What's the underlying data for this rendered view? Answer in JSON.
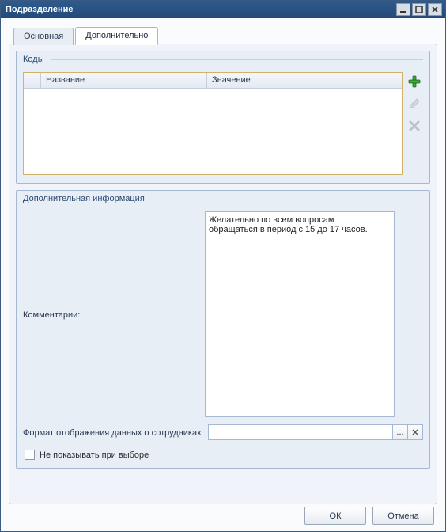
{
  "window": {
    "title": "Подразделение"
  },
  "tabs": {
    "main": "Основная",
    "extra": "Дополнительно"
  },
  "codes_group": {
    "legend": "Коды",
    "columns": {
      "name": "Название",
      "value": "Значение"
    }
  },
  "info_group": {
    "legend": "Дополнительная информация",
    "comments_label": "Комментарии:",
    "comments_value": "Желательно по всем вопросам обращаться в период с 15 до 17 часов.",
    "format_label": "Формат отображения данных о сотрудниках",
    "format_value": "",
    "format_ellipsis": "...",
    "hide_checkbox_label": "Не показывать при выборе"
  },
  "buttons": {
    "ok": "ОК",
    "cancel": "Отмена"
  },
  "icons": {
    "add": "add-icon",
    "edit": "edit-icon",
    "delete": "delete-icon",
    "minimize": "minimize-icon",
    "maximize": "maximize-icon",
    "close": "close-icon",
    "clear": "clear-icon"
  }
}
